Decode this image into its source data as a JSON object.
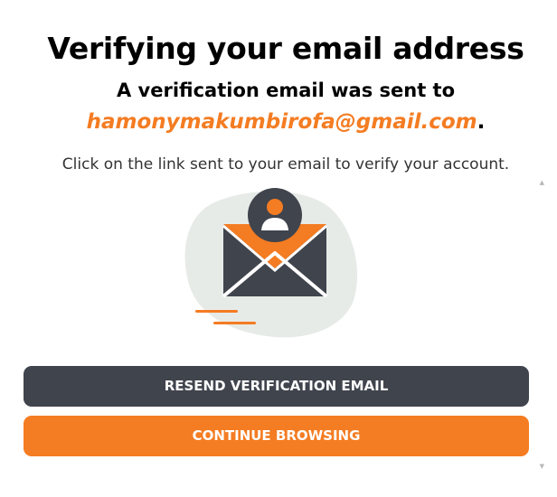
{
  "dialog": {
    "title": "Verifying your email address",
    "subtitle": "A verification email was sent to",
    "email": "hamonymakumbirofa@gmail.com",
    "email_suffix": ".",
    "instructions": "Click on the link sent to your email to verify your account.",
    "illustration_icon": "envelope-with-user-icon",
    "colors": {
      "accent": "#f47c22",
      "dark": "#40444d"
    }
  },
  "buttons": {
    "resend_label": "RESEND VERIFICATION EMAIL",
    "continue_label": "CONTINUE BROWSING"
  },
  "scrollbar": {
    "up_icon": "▲",
    "down_icon": "▼"
  }
}
